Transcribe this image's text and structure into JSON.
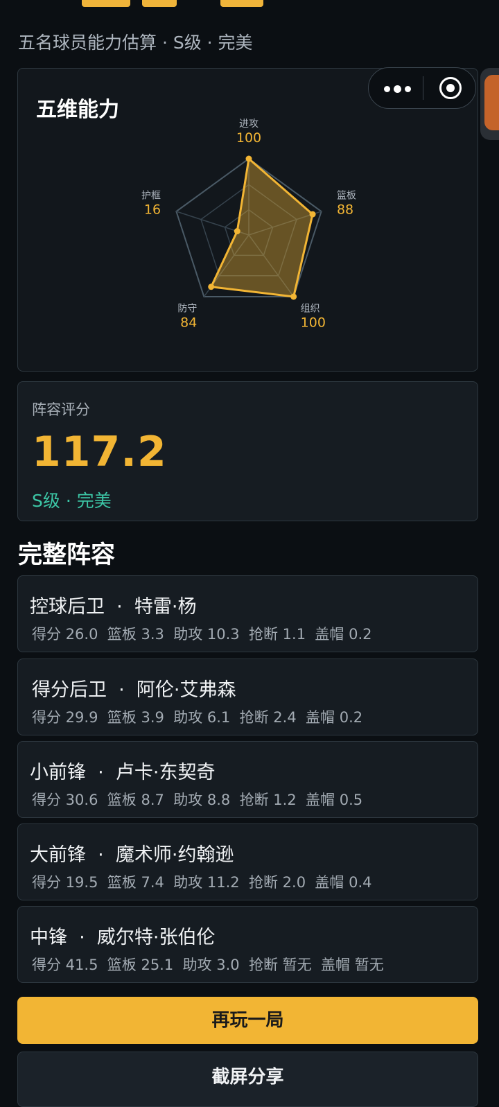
{
  "subtitle": "五名球员能力估算 · S级 · 完美",
  "radar": {
    "title": "五维能力",
    "axes": [
      {
        "label": "进攻",
        "value": "100"
      },
      {
        "label": "篮板",
        "value": "88"
      },
      {
        "label": "组织",
        "value": "100"
      },
      {
        "label": "防守",
        "value": "84"
      },
      {
        "label": "护框",
        "value": "16"
      }
    ]
  },
  "score": {
    "label": "阵容评分",
    "value": "117.2",
    "grade": "S级 · 完美"
  },
  "lineup": {
    "title": "完整阵容",
    "players": [
      {
        "name": "控球后卫  ·  特雷·杨",
        "stats": "得分 26.0  篮板 3.3  助攻 10.3  抢断 1.1  盖帽 0.2"
      },
      {
        "name": "得分后卫  ·  阿伦·艾弗森",
        "stats": "得分 29.9  篮板 3.9  助攻 6.1  抢断 2.4  盖帽 0.2"
      },
      {
        "name": "小前锋  ·  卢卡·东契奇",
        "stats": "得分 30.6  篮板 8.7  助攻 8.8  抢断 1.2  盖帽 0.5"
      },
      {
        "name": "大前锋  ·  魔术师·约翰逊",
        "stats": "得分 19.5  篮板 7.4  助攻 11.2  抢断 2.0  盖帽 0.4"
      },
      {
        "name": "中锋  ·  威尔特·张伯伦",
        "stats": "得分 41.5  篮板 25.1  助攻 3.0  抢断 暂无  盖帽 暂无"
      }
    ]
  },
  "buttons": {
    "replay": "再玩一局",
    "share": "截屏分享"
  },
  "colors": {
    "accent": "#f2b534",
    "grade": "#3cc6a6",
    "background": "#0b0f13",
    "card": "#161c22"
  },
  "icons": {
    "more": "more-dots-icon",
    "close": "target-close-icon"
  }
}
